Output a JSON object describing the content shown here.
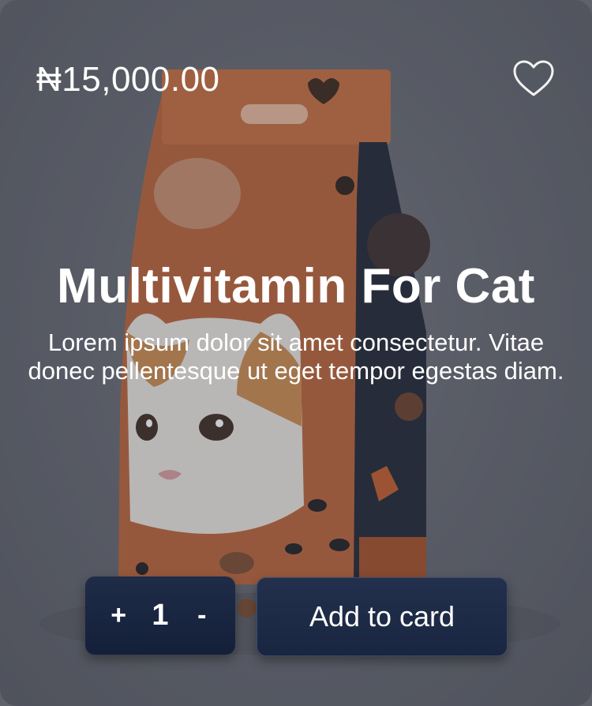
{
  "product": {
    "price": "₦15,000.00",
    "title": "Multivitamin For Cat",
    "description": "Lorem ipsum dolor sit amet consectetur. Vitae donec pellentesque ut eget tempor egestas diam."
  },
  "quantity": {
    "increment_label": "+",
    "value": "1",
    "decrement_label": "-"
  },
  "actions": {
    "add_label": "Add to card"
  },
  "icons": {
    "favorite": "heart-outline-icon"
  },
  "colors": {
    "card_background": "#62656e",
    "button_navy": "#1a2640",
    "text": "#ffffff",
    "bag_orange": "#c0683a",
    "bag_dark": "#1b2233"
  }
}
